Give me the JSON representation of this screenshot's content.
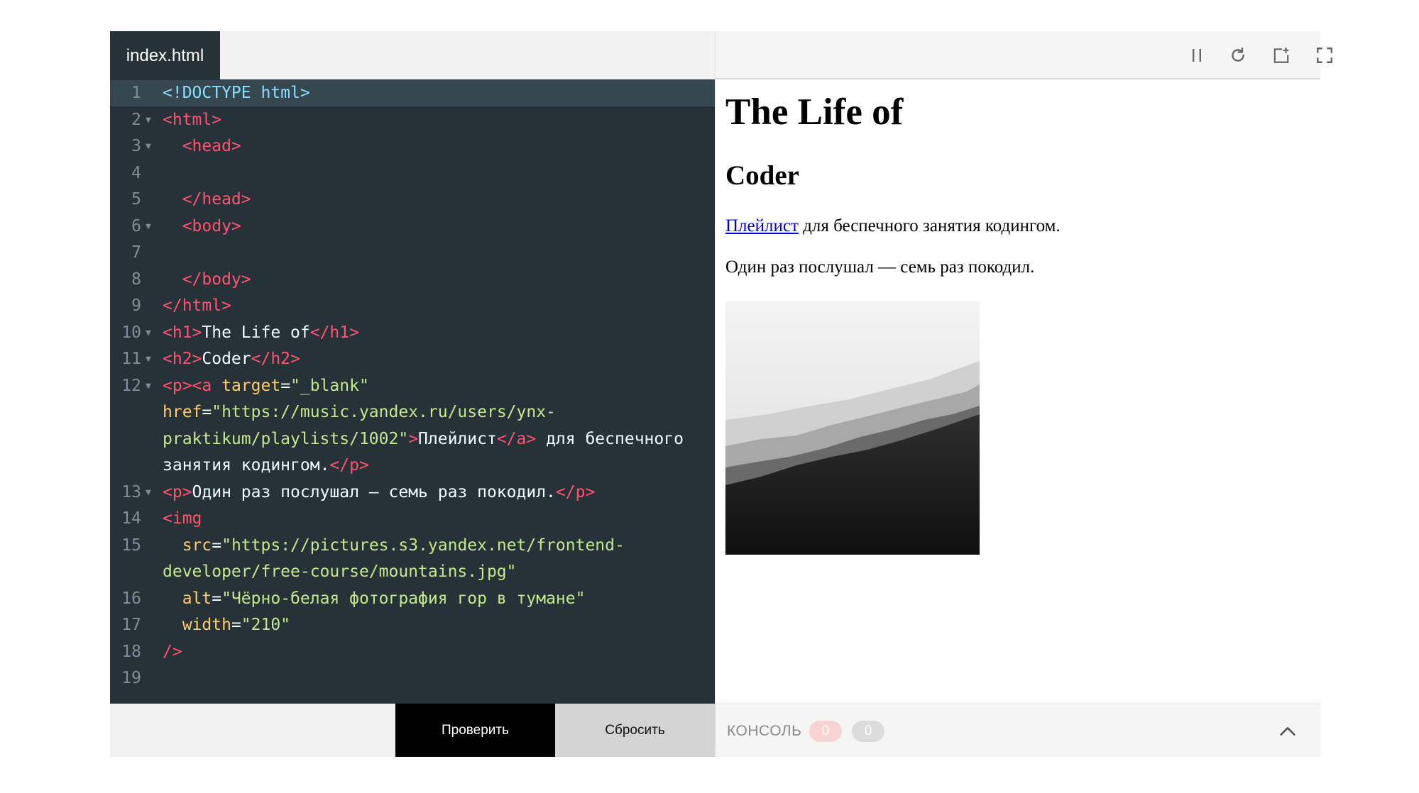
{
  "editor": {
    "file_tab": "index.html",
    "lines": [
      {
        "n": "1",
        "fold": false,
        "active": true,
        "segs": [
          {
            "c": "dc",
            "t": "<!DOCTYPE html>"
          }
        ]
      },
      {
        "n": "2",
        "fold": true,
        "segs": [
          {
            "c": "tg",
            "t": "<html>"
          }
        ]
      },
      {
        "n": "3",
        "fold": true,
        "segs": [
          {
            "c": "tg",
            "t": "  <head>"
          }
        ]
      },
      {
        "n": "4",
        "fold": false,
        "segs": []
      },
      {
        "n": "5",
        "fold": false,
        "segs": [
          {
            "c": "tg",
            "t": "  </head>"
          }
        ]
      },
      {
        "n": "6",
        "fold": true,
        "segs": [
          {
            "c": "tg",
            "t": "  <body>"
          }
        ]
      },
      {
        "n": "7",
        "fold": false,
        "segs": []
      },
      {
        "n": "8",
        "fold": false,
        "segs": [
          {
            "c": "tg",
            "t": "  </body>"
          }
        ]
      },
      {
        "n": "9",
        "fold": false,
        "segs": [
          {
            "c": "tg",
            "t": "</html>"
          }
        ]
      },
      {
        "n": "10",
        "fold": true,
        "segs": [
          {
            "c": "tg",
            "t": "<h1>"
          },
          {
            "c": "tx",
            "t": "The Life of"
          },
          {
            "c": "tg",
            "t": "</h1>"
          }
        ]
      },
      {
        "n": "11",
        "fold": true,
        "segs": [
          {
            "c": "tg",
            "t": "<h2>"
          },
          {
            "c": "tx",
            "t": "Coder"
          },
          {
            "c": "tg",
            "t": "</h2>"
          }
        ]
      },
      {
        "n": "12",
        "fold": true,
        "segs": [
          {
            "c": "tg",
            "t": "<p><a "
          },
          {
            "c": "at",
            "t": "target"
          },
          {
            "c": "tx",
            "t": "="
          },
          {
            "c": "av",
            "t": "\"_blank\""
          }
        ]
      },
      {
        "n": "",
        "fold": false,
        "segs": [
          {
            "c": "at",
            "t": "href"
          },
          {
            "c": "tx",
            "t": "="
          },
          {
            "c": "av",
            "t": "\"https://music.yandex.ru/users/ynx-"
          }
        ]
      },
      {
        "n": "",
        "fold": false,
        "segs": [
          {
            "c": "av",
            "t": "praktikum/playlists/1002\""
          },
          {
            "c": "tg",
            "t": ">"
          },
          {
            "c": "tx",
            "t": "Плейлист"
          },
          {
            "c": "tg",
            "t": "</a>"
          },
          {
            "c": "tx",
            "t": " для беспечного"
          }
        ]
      },
      {
        "n": "",
        "fold": false,
        "segs": [
          {
            "c": "tx",
            "t": "занятия кодингом."
          },
          {
            "c": "tg",
            "t": "</p>"
          }
        ]
      },
      {
        "n": "13",
        "fold": true,
        "segs": [
          {
            "c": "tg",
            "t": "<p>"
          },
          {
            "c": "tx",
            "t": "Один раз послушал — семь раз покодил."
          },
          {
            "c": "tg",
            "t": "</p>"
          }
        ]
      },
      {
        "n": "14",
        "fold": false,
        "segs": [
          {
            "c": "tg",
            "t": "<img"
          }
        ]
      },
      {
        "n": "15",
        "fold": false,
        "segs": [
          {
            "c": "at",
            "t": "  src"
          },
          {
            "c": "tx",
            "t": "="
          },
          {
            "c": "av",
            "t": "\"https://pictures.s3.yandex.net/frontend-"
          }
        ]
      },
      {
        "n": "",
        "fold": false,
        "segs": [
          {
            "c": "av",
            "t": "developer/free-course/mountains.jpg\""
          }
        ]
      },
      {
        "n": "16",
        "fold": false,
        "segs": [
          {
            "c": "at",
            "t": "  alt"
          },
          {
            "c": "tx",
            "t": "="
          },
          {
            "c": "av",
            "t": "\"Чёрно-белая фотография гор в тумане\""
          }
        ]
      },
      {
        "n": "17",
        "fold": false,
        "segs": [
          {
            "c": "at",
            "t": "  width"
          },
          {
            "c": "tx",
            "t": "="
          },
          {
            "c": "av",
            "t": "\"210\""
          }
        ]
      },
      {
        "n": "18",
        "fold": false,
        "segs": [
          {
            "c": "tg",
            "t": "/>"
          }
        ]
      },
      {
        "n": "19",
        "fold": false,
        "segs": []
      }
    ],
    "check_label": "Проверить",
    "reset_label": "Сбросить"
  },
  "toolbar": {
    "icons": [
      "pause-icon",
      "reload-icon",
      "open-new-window-icon",
      "fullscreen-icon"
    ]
  },
  "preview": {
    "h1": "The Life of",
    "h2": "Coder",
    "link_text": "Плейлист",
    "p1_rest": " для беспечного занятия кодингом.",
    "p2": "Один раз послушал — семь раз покодил."
  },
  "console": {
    "label": "КОНСОЛЬ",
    "errors": "0",
    "warnings": "0"
  },
  "colors": {
    "editor_bg": "#263238",
    "tag": "#ff5370",
    "attribute": "#ffcb6b",
    "string": "#c3e88d",
    "check_button": "#000000",
    "reset_button": "#d4d4d4"
  }
}
